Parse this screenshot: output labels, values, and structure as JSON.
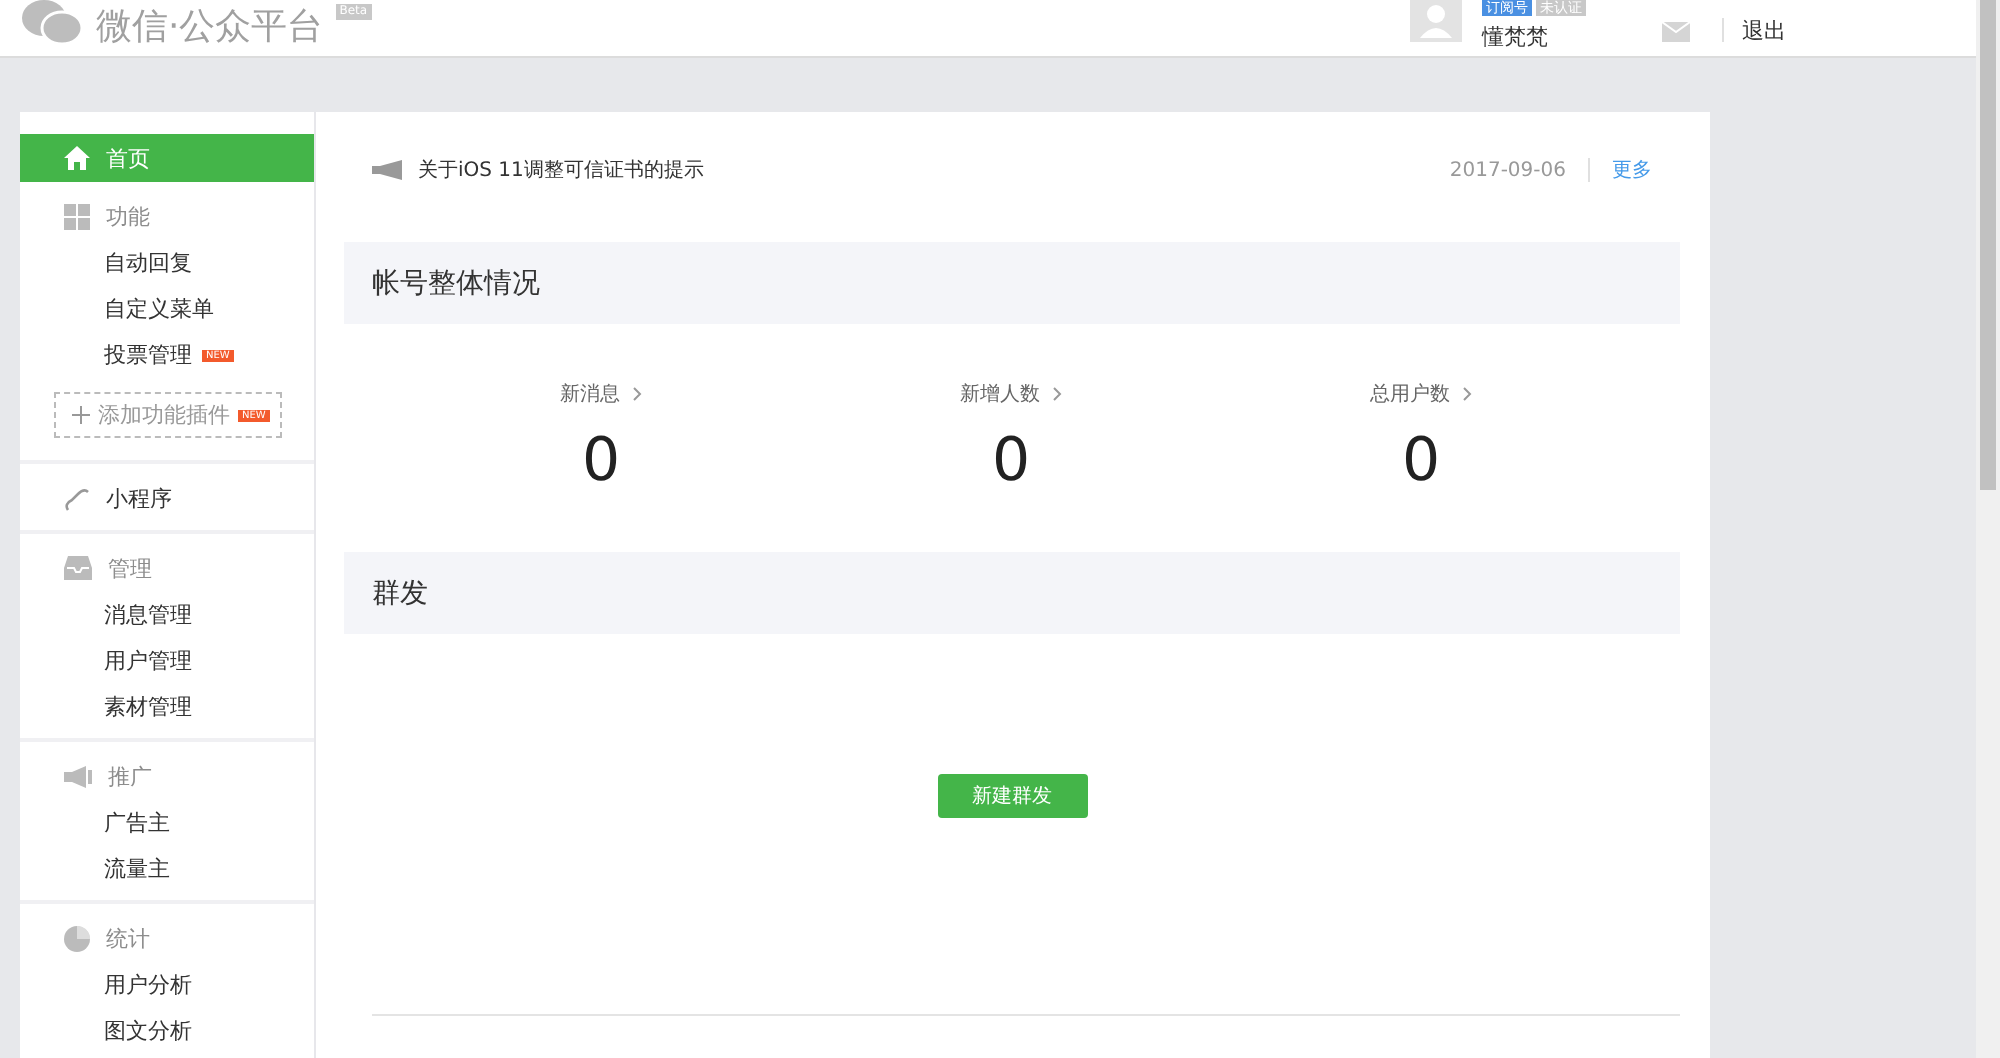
{
  "header": {
    "title": "微信·公众平台",
    "title_badge": "Beta",
    "account_tags": [
      "订阅号",
      "未认证"
    ],
    "user_name": "懂梵梵",
    "logout": "退出"
  },
  "sidebar": {
    "home": {
      "label": "首页",
      "selected": true
    },
    "groups": [
      {
        "label": "功能",
        "children": [
          {
            "label": "自动回复",
            "selected": false
          },
          {
            "label": "自定义菜单",
            "selected": false
          },
          {
            "label": "投票管理",
            "selected": false,
            "badge": "NEW"
          }
        ],
        "add_plugin": {
          "label": "添加功能插件",
          "badge": "NEW"
        }
      },
      {
        "label": "小程序",
        "kind": "link"
      },
      {
        "label": "管理",
        "children": [
          {
            "label": "消息管理",
            "selected": false
          },
          {
            "label": "用户管理",
            "selected": false
          },
          {
            "label": "素材管理",
            "selected": false
          }
        ]
      },
      {
        "label": "推广",
        "children": [
          {
            "label": "广告主",
            "selected": false
          },
          {
            "label": "流量主",
            "selected": false
          }
        ]
      },
      {
        "label": "统计",
        "children": [
          {
            "label": "用户分析",
            "selected": false
          },
          {
            "label": "图文分析",
            "selected": false
          }
        ]
      }
    ]
  },
  "notice": {
    "title": "关于iOS 11调整可信证书的提示",
    "date": "2017-09-06",
    "more": "更多"
  },
  "account_overview": {
    "title": "帐号整体情况",
    "stats": [
      {
        "label": "新消息",
        "value": "0"
      },
      {
        "label": "新增人数",
        "value": "0"
      },
      {
        "label": "总用户数",
        "value": "0"
      }
    ]
  },
  "mass_send": {
    "title": "群发",
    "button": "新建群发"
  }
}
